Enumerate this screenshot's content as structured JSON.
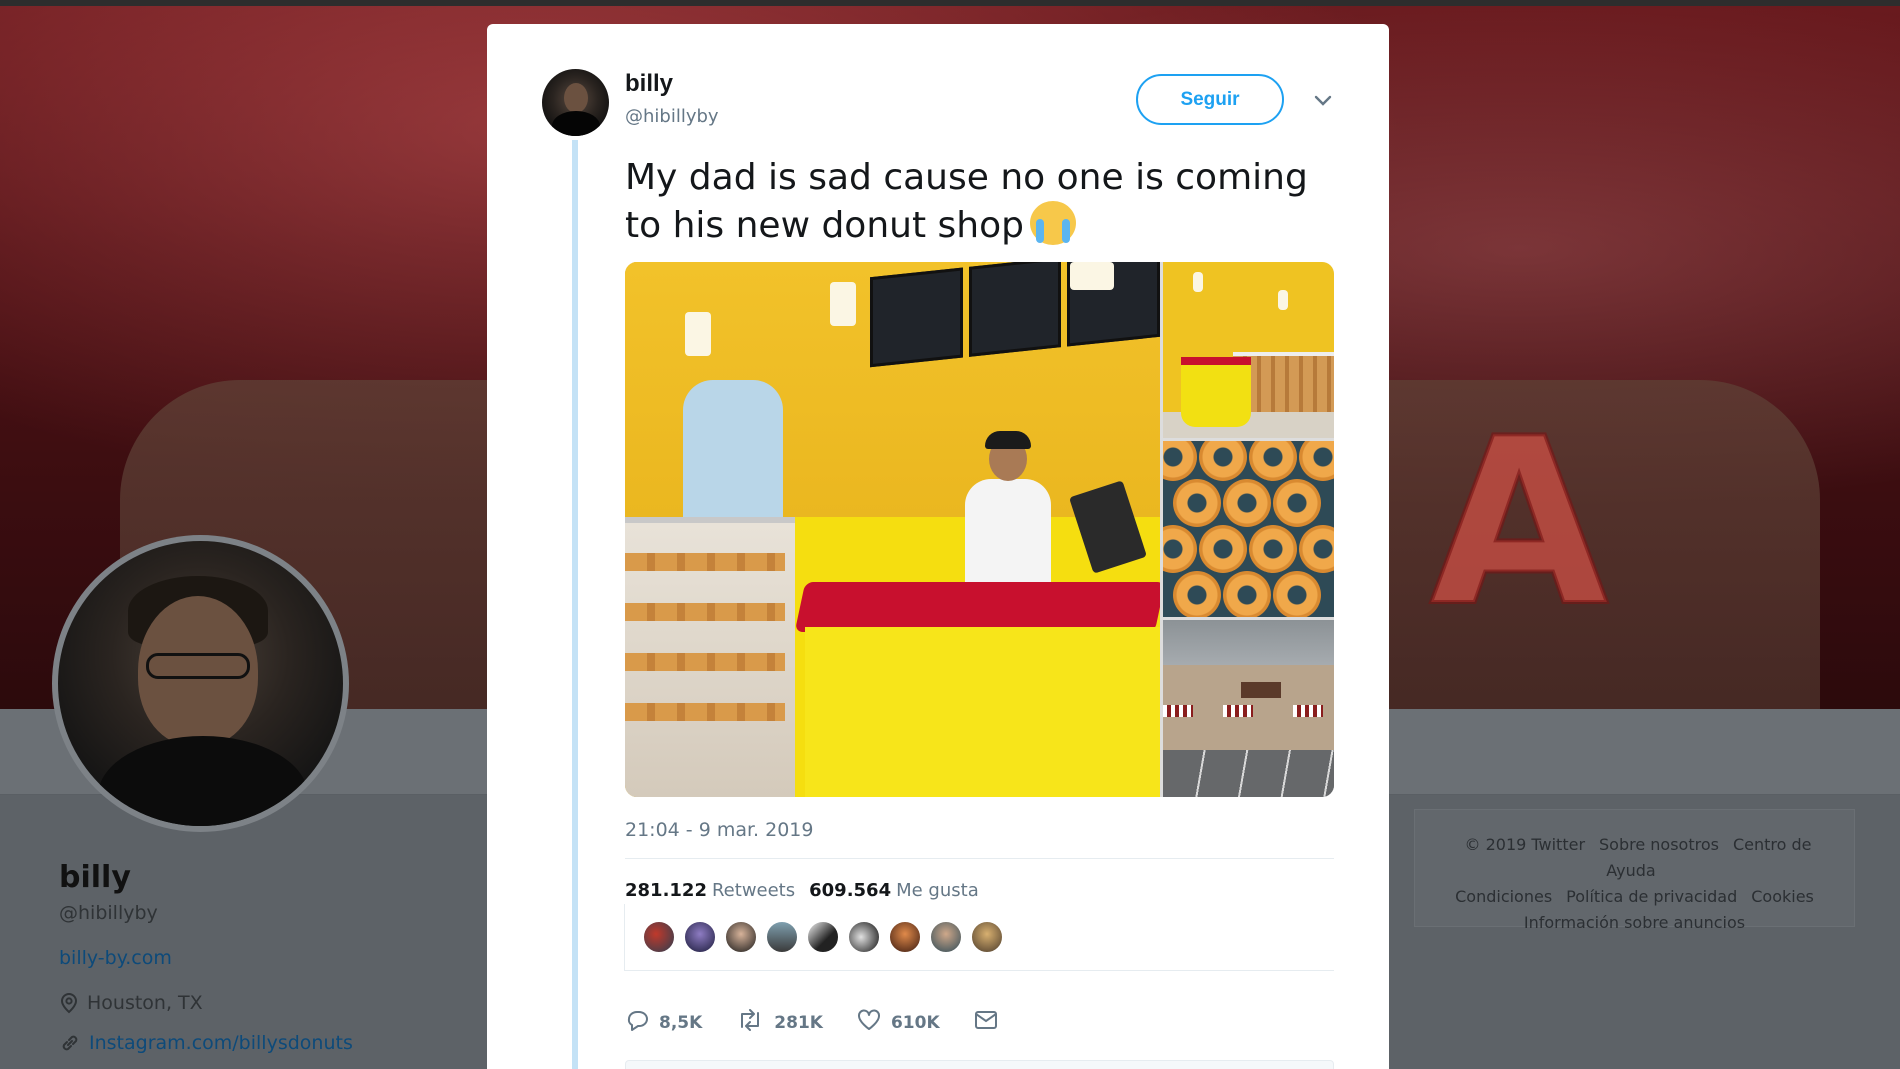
{
  "profile": {
    "name": "billy",
    "handle": "@hibillyby",
    "website": "billy-by.com",
    "location": "Houston, TX",
    "instagram": "Instagram.com/billysdonuts"
  },
  "footer": {
    "links": [
      "© 2019 Twitter",
      "Sobre nosotros",
      "Centro de Ayuda",
      "Condiciones",
      "Política de privacidad",
      "Cookies",
      "Información sobre anuncios"
    ]
  },
  "tweet": {
    "author_name": "billy",
    "author_handle": "@hibillyby",
    "follow_label": "Seguir",
    "text": "My dad is sad cause no one is coming to his new donut shop",
    "emoji": "loudly-crying-face",
    "timestamp": "21:04 - 9 mar. 2019",
    "retweets_count": "281.122",
    "retweets_label": "Retweets",
    "likes_count": "609.564",
    "likes_label": "Me gusta",
    "actions": {
      "reply_count": "8,5K",
      "retweet_count": "281K",
      "like_count": "610K"
    },
    "icons": {
      "reply": "reply-icon",
      "retweet": "retweet-icon",
      "like": "heart-icon",
      "dm": "envelope-icon",
      "menu": "chevron-down-icon"
    }
  },
  "colors": {
    "accent": "#1da1f2",
    "text_primary": "#14171a",
    "text_secondary": "#657786",
    "thread_line": "#c4e2f6"
  }
}
